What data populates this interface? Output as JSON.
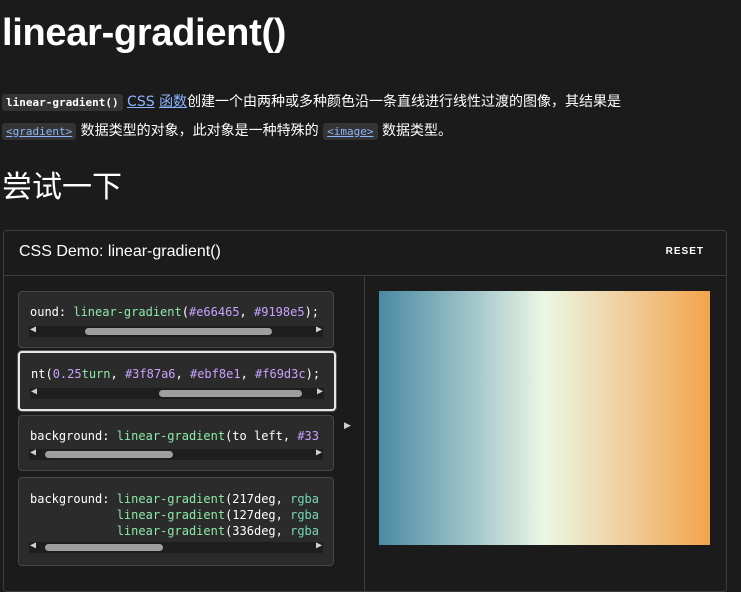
{
  "page": {
    "title": "linear-gradient()",
    "intro": {
      "fn_code": "linear-gradient()",
      "css_link": "CSS",
      "func_link": "函数",
      "text1": "创建一个由两种或多种颜色沿一条直线进行线性过渡的图像，其结果是",
      "gradient_code": "<gradient>",
      "text2": " 数据类型的对象，此对象是一种特殊的 ",
      "image_code": "<image>",
      "text3": " 数据类型。"
    },
    "section_title": "尝试一下"
  },
  "demo": {
    "title": "CSS Demo: linear-gradient()",
    "reset_label": "RESET",
    "choices": [
      {
        "lines": [
          [
            {
              "t": "ound: ",
              "c": "plain"
            },
            {
              "t": "linear-gradient",
              "c": "fn"
            },
            {
              "t": "(",
              "c": "plain"
            },
            {
              "t": "#e66465",
              "c": "hash"
            },
            {
              "t": ", ",
              "c": "plain"
            },
            {
              "t": "#9198e5",
              "c": "hash"
            },
            {
              "t": ");",
              "c": "plain"
            }
          ]
        ],
        "scroll": 0.58,
        "thumb": 0.73
      },
      {
        "lines": [
          [
            {
              "t": "nt(",
              "c": "plain"
            },
            {
              "t": "0.25",
              "c": "num"
            },
            {
              "t": "turn",
              "c": "fn"
            },
            {
              "t": ", ",
              "c": "plain"
            },
            {
              "t": "#3f87a6",
              "c": "hash"
            },
            {
              "t": ", ",
              "c": "plain"
            },
            {
              "t": "#ebf8e1",
              "c": "hash"
            },
            {
              "t": ", ",
              "c": "plain"
            },
            {
              "t": "#f69d3c",
              "c": "hash"
            },
            {
              "t": ");",
              "c": "plain"
            }
          ]
        ],
        "scroll": 1.0,
        "thumb": 0.56
      },
      {
        "lines": [
          [
            {
              "t": "background: ",
              "c": "plain"
            },
            {
              "t": "linear-gradient",
              "c": "fn"
            },
            {
              "t": "(to left, ",
              "c": "plain"
            },
            {
              "t": "#33",
              "c": "hash"
            }
          ]
        ],
        "scroll": 0.0,
        "thumb": 0.5
      },
      {
        "lines": [
          [
            {
              "t": "background: ",
              "c": "plain"
            },
            {
              "t": "linear-gradient",
              "c": "fn"
            },
            {
              "t": "(217deg, ",
              "c": "plain"
            },
            {
              "t": "rgba",
              "c": "fn2"
            }
          ],
          [
            {
              "t": "            ",
              "c": "plain"
            },
            {
              "t": "linear-gradient",
              "c": "fn"
            },
            {
              "t": "(127deg, ",
              "c": "plain"
            },
            {
              "t": "rgba",
              "c": "fn2"
            }
          ],
          [
            {
              "t": "            ",
              "c": "plain"
            },
            {
              "t": "linear-gradient",
              "c": "fn"
            },
            {
              "t": "(336deg, ",
              "c": "plain"
            },
            {
              "t": "rgba",
              "c": "fn2"
            }
          ]
        ],
        "scroll": 0.0,
        "thumb": 0.46
      }
    ],
    "output_gradient": {
      "angle": "0.25turn",
      "stops": [
        "#3f87a6",
        "#ebf8e1",
        "#f69d3c"
      ]
    }
  },
  "colors": {
    "background": "#1b1b1b",
    "link": "#8cb4ff",
    "function": "#8be9a8",
    "number": "#c8a2ff"
  },
  "icons": {
    "scroll_left": "triangle-left-icon",
    "scroll_right": "triangle-right-icon",
    "selected_pointer": "triangle-right-icon"
  }
}
